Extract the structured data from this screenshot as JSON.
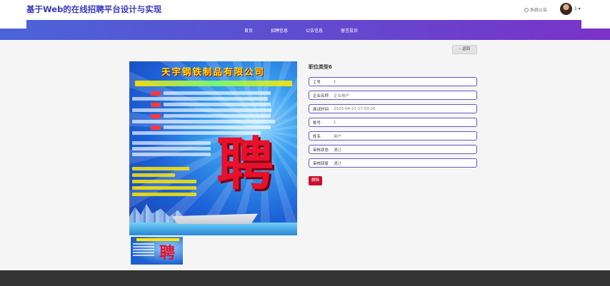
{
  "header": {
    "site_title": "基于Web的在线招聘平台设计与实现",
    "notice_label": "系统公告",
    "user_label": "1 ▾"
  },
  "nav": {
    "items": [
      "首页",
      "招聘信息",
      "公告信息",
      "留言投诉"
    ]
  },
  "detail": {
    "back_label": "‹ 返回",
    "title": "职位类型6",
    "fields": [
      {
        "label": "工号",
        "value": "1"
      },
      {
        "label": "企业名称",
        "value": "企业用户"
      },
      {
        "label": "面试时间",
        "value": "2025-04-21 17:53:20"
      },
      {
        "label": "账号",
        "value": "1"
      },
      {
        "label": "姓名",
        "value": "用户"
      },
      {
        "label": "审核状态",
        "value": "通过"
      },
      {
        "label": "审核回复",
        "value": "通过"
      }
    ],
    "delete_label": "删除"
  },
  "poster": {
    "company": "天宇钢铁制品有限公司",
    "big_char": "聘"
  },
  "colors": {
    "title_blue": "#3a3ab8",
    "nav_gradient_start": "#4a64d8",
    "nav_gradient_end": "#7a32c8",
    "field_border": "#6b52c8",
    "delete_red": "#c8102e",
    "footer": "#333333"
  }
}
